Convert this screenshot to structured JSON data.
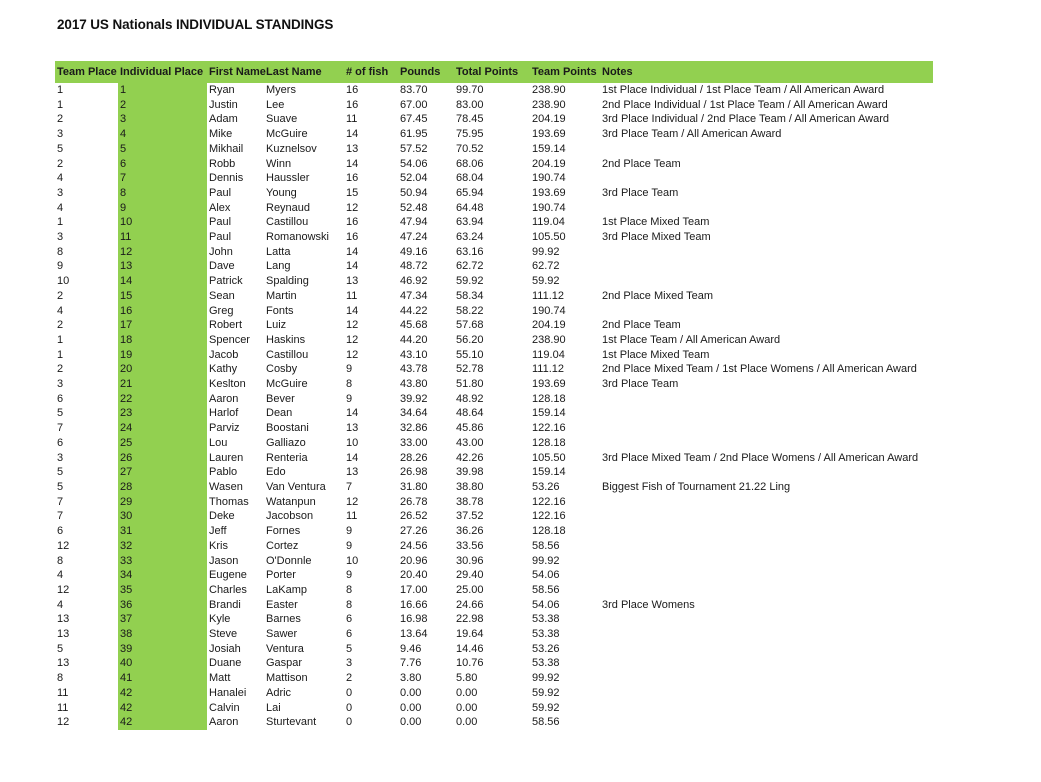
{
  "document": {
    "title": "2017 US Nationals INDIVIDUAL STANDINGS"
  },
  "colors": {
    "header_green": "#92d050",
    "highlight_green": "#92d050",
    "text": "#1a1a1a",
    "background": "#ffffff"
  },
  "table": {
    "columns": [
      "Team Place",
      "Individual Place",
      "First Name",
      "Last Name",
      "# of fish",
      "Pounds",
      "Total Points",
      "Team Points",
      "Notes"
    ],
    "rows": [
      [
        "1",
        "1",
        "Ryan",
        "Myers",
        "16",
        "83.70",
        "99.70",
        "238.90",
        "1st Place Individual / 1st Place Team / All American Award"
      ],
      [
        "1",
        "2",
        "Justin",
        "Lee",
        "16",
        "67.00",
        "83.00",
        "238.90",
        "2nd Place Individual / 1st Place Team / All American Award"
      ],
      [
        "2",
        "3",
        "Adam",
        "Suave",
        "11",
        "67.45",
        "78.45",
        "204.19",
        "3rd Place Individual / 2nd Place Team / All American Award"
      ],
      [
        "3",
        "4",
        "Mike",
        "McGuire",
        "14",
        "61.95",
        "75.95",
        "193.69",
        "3rd Place Team / All American Award"
      ],
      [
        "5",
        "5",
        "Mikhail",
        "Kuznelsov",
        "13",
        "57.52",
        "70.52",
        "159.14",
        ""
      ],
      [
        "2",
        "6",
        "Robb",
        "Winn",
        "14",
        "54.06",
        "68.06",
        "204.19",
        "2nd Place Team"
      ],
      [
        "4",
        "7",
        "Dennis",
        "Haussler",
        "16",
        "52.04",
        "68.04",
        "190.74",
        ""
      ],
      [
        "3",
        "8",
        "Paul",
        "Young",
        "15",
        "50.94",
        "65.94",
        "193.69",
        "3rd Place Team"
      ],
      [
        "4",
        "9",
        "Alex",
        "Reynaud",
        "12",
        "52.48",
        "64.48",
        "190.74",
        ""
      ],
      [
        "1",
        "10",
        "Paul",
        "Castillou",
        "16",
        "47.94",
        "63.94",
        "119.04",
        "1st Place Mixed Team"
      ],
      [
        "3",
        "11",
        "Paul",
        "Romanowski",
        "16",
        "47.24",
        "63.24",
        "105.50",
        "3rd Place Mixed Team"
      ],
      [
        "8",
        "12",
        "John",
        "Latta",
        "14",
        "49.16",
        "63.16",
        "99.92",
        ""
      ],
      [
        "9",
        "13",
        "Dave",
        "Lang",
        "14",
        "48.72",
        "62.72",
        "62.72",
        ""
      ],
      [
        "10",
        "14",
        "Patrick",
        "Spalding",
        "13",
        "46.92",
        "59.92",
        "59.92",
        ""
      ],
      [
        "2",
        "15",
        "Sean",
        "Martin",
        "11",
        "47.34",
        "58.34",
        "111.12",
        "2nd Place Mixed Team"
      ],
      [
        "4",
        "16",
        "Greg",
        "Fonts",
        "14",
        "44.22",
        "58.22",
        "190.74",
        ""
      ],
      [
        "2",
        "17",
        "Robert",
        "Luiz",
        "12",
        "45.68",
        "57.68",
        "204.19",
        "2nd Place Team"
      ],
      [
        "1",
        "18",
        "Spencer",
        "Haskins",
        "12",
        "44.20",
        "56.20",
        "238.90",
        "1st Place Team / All American Award"
      ],
      [
        "1",
        "19",
        "Jacob",
        "Castillou",
        "12",
        "43.10",
        "55.10",
        "119.04",
        "1st Place Mixed Team"
      ],
      [
        "2",
        "20",
        "Kathy",
        "Cosby",
        "9",
        "43.78",
        "52.78",
        "111.12",
        "2nd Place Mixed Team / 1st Place Womens / All American Award"
      ],
      [
        "3",
        "21",
        "Keslton",
        "McGuire",
        "8",
        "43.80",
        "51.80",
        "193.69",
        "3rd Place Team"
      ],
      [
        "6",
        "22",
        "Aaron",
        "Bever",
        "9",
        "39.92",
        "48.92",
        "128.18",
        ""
      ],
      [
        "5",
        "23",
        "Harlof",
        "Dean",
        "14",
        "34.64",
        "48.64",
        "159.14",
        ""
      ],
      [
        "7",
        "24",
        "Parviz",
        "Boostani",
        "13",
        "32.86",
        "45.86",
        "122.16",
        ""
      ],
      [
        "6",
        "25",
        "Lou",
        "Galliazo",
        "10",
        "33.00",
        "43.00",
        "128.18",
        ""
      ],
      [
        "3",
        "26",
        "Lauren",
        "Renteria",
        "14",
        "28.26",
        "42.26",
        "105.50",
        "3rd Place Mixed Team / 2nd Place Womens / All American Award"
      ],
      [
        "5",
        "27",
        "Pablo",
        "Edo",
        "13",
        "26.98",
        "39.98",
        "159.14",
        ""
      ],
      [
        "5",
        "28",
        "Wasen",
        "Van Ventura",
        "7",
        "31.80",
        "38.80",
        "53.26",
        "Biggest Fish of Tournament 21.22 Ling"
      ],
      [
        "7",
        "29",
        "Thomas",
        "Watanpun",
        "12",
        "26.78",
        "38.78",
        "122.16",
        ""
      ],
      [
        "7",
        "30",
        "Deke",
        "Jacobson",
        "11",
        "26.52",
        "37.52",
        "122.16",
        ""
      ],
      [
        "6",
        "31",
        "Jeff",
        "Fornes",
        "9",
        "27.26",
        "36.26",
        "128.18",
        ""
      ],
      [
        "12",
        "32",
        "Kris",
        "Cortez",
        "9",
        "24.56",
        "33.56",
        "58.56",
        ""
      ],
      [
        "8",
        "33",
        "Jason",
        "O'Donnle",
        "10",
        "20.96",
        "30.96",
        "99.92",
        ""
      ],
      [
        "4",
        "34",
        "Eugene",
        "Porter",
        "9",
        "20.40",
        "29.40",
        "54.06",
        ""
      ],
      [
        "12",
        "35",
        "Charles",
        "LaKamp",
        "8",
        "17.00",
        "25.00",
        "58.56",
        ""
      ],
      [
        "4",
        "36",
        "Brandi",
        "Easter",
        "8",
        "16.66",
        "24.66",
        "54.06",
        "3rd Place Womens"
      ],
      [
        "13",
        "37",
        "Kyle",
        "Barnes",
        "6",
        "16.98",
        "22.98",
        "53.38",
        ""
      ],
      [
        "13",
        "38",
        "Steve",
        "Sawer",
        "6",
        "13.64",
        "19.64",
        "53.38",
        ""
      ],
      [
        "5",
        "39",
        "Josiah",
        "Ventura",
        "5",
        "9.46",
        "14.46",
        "53.26",
        ""
      ],
      [
        "13",
        "40",
        "Duane",
        "Gaspar",
        "3",
        "7.76",
        "10.76",
        "53.38",
        ""
      ],
      [
        "8",
        "41",
        "Matt",
        "Mattison",
        "2",
        "3.80",
        "5.80",
        "99.92",
        ""
      ],
      [
        "11",
        "42",
        "Hanalei",
        "Adric",
        "0",
        "0.00",
        "0.00",
        "59.92",
        ""
      ],
      [
        "11",
        "42",
        "Calvin",
        "Lai",
        "0",
        "0.00",
        "0.00",
        "59.92",
        ""
      ],
      [
        "12",
        "42",
        "Aaron",
        "Sturtevant",
        "0",
        "0.00",
        "0.00",
        "58.56",
        ""
      ]
    ]
  }
}
